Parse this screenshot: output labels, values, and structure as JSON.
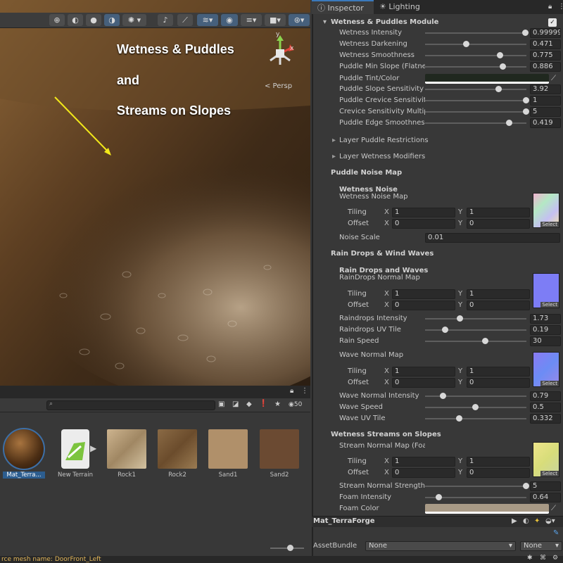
{
  "scene": {
    "overlay_lines": [
      "Wetness & Puddles",
      "and",
      "Streams on Slopes"
    ],
    "persp_label": "< Persp",
    "gizmo_axes": {
      "y": "y",
      "x": "x"
    },
    "toolbar_icons": [
      "globe-icon",
      "sphere-shaded-icon",
      "sphere-solid-icon",
      "moon-icon",
      "sun-icon",
      "audio-mute-icon",
      "fx-icon",
      "layers-icon",
      "visibility-icon",
      "stack-icon",
      "camera-icon",
      "gizmo-icon"
    ],
    "annotation_arrow_color": "#f2e81a"
  },
  "project": {
    "search_placeholder": "",
    "count_label": "50",
    "assets": [
      {
        "name": "Mat_Terra...",
        "kind": "material"
      },
      {
        "name": "New Terrain",
        "kind": "terrain"
      },
      {
        "name": "Rock1",
        "kind": "texture"
      },
      {
        "name": "Rock2",
        "kind": "texture"
      },
      {
        "name": "Sand1",
        "kind": "texture"
      },
      {
        "name": "Sand2",
        "kind": "texture"
      }
    ]
  },
  "status_text": "rce mesh name: DoorFront_Left",
  "inspector": {
    "tabs": [
      {
        "label": "Inspector"
      },
      {
        "label": "Lighting"
      }
    ],
    "module_title": "Wetness & Puddles Module",
    "module_enabled": true,
    "sliders": [
      {
        "label": "Wetness Intensity",
        "value": "0.99999",
        "fraction": 0.995
      },
      {
        "label": "Wetness Darkening",
        "value": "0.471",
        "fraction": 0.41
      },
      {
        "label": "Wetness Smoothness",
        "value": "0.775",
        "fraction": 0.74
      },
      {
        "label": "Puddle Min Slope (Flatness)",
        "value": "0.886",
        "fraction": 0.77
      },
      {
        "label": "Puddle Slope Sensitivity",
        "value": "3.92",
        "fraction": 0.73
      },
      {
        "label": "Puddle Crevice Sensitivity",
        "value": "1",
        "fraction": 1.0
      },
      {
        "label": "Crevice Sensitivity Multiplier",
        "value": "5",
        "fraction": 1.0
      },
      {
        "label": "Puddle Edge Smoothness",
        "value": "0.419",
        "fraction": 0.83
      }
    ],
    "puddle_tint_label": "Puddle Tint/Color",
    "foldouts": [
      "Layer Puddle Restrictions",
      "Layer Wetness Modifiers"
    ],
    "puddle_noise": {
      "header": "Puddle Noise Map",
      "sub_header": "Wetness Noise",
      "map_label": "Wetness Noise Map",
      "tiling_label": "Tiling",
      "offset_label": "Offset",
      "tiling": {
        "x": "1",
        "y": "1"
      },
      "offset": {
        "x": "0",
        "y": "0"
      },
      "noise_scale_label": "Noise Scale",
      "noise_scale": "0.01",
      "select_label": "Select"
    },
    "rain": {
      "header": "Rain Drops & Wind Waves",
      "sub_header": "Rain Drops and Waves",
      "map_label": "RainDrops Normal Map",
      "tiling": {
        "x": "1",
        "y": "1"
      },
      "offset": {
        "x": "0",
        "y": "0"
      },
      "sliders": [
        {
          "label": "Raindrops Intensity",
          "value": "1.73",
          "fraction": 0.35
        },
        {
          "label": "Raindrops UV Tile",
          "value": "0.19",
          "fraction": 0.2
        },
        {
          "label": "Rain Speed",
          "value": "30",
          "fraction": 0.6
        }
      ],
      "wave_map_label": "Wave Normal Map",
      "wave_tiling": {
        "x": "1",
        "y": "1"
      },
      "wave_offset": {
        "x": "0",
        "y": "0"
      },
      "wave_sliders": [
        {
          "label": "Wave Normal Intensity",
          "value": "0.79",
          "fraction": 0.18
        },
        {
          "label": "Wave Speed",
          "value": "0.5",
          "fraction": 0.5
        },
        {
          "label": "Wave UV Tile",
          "value": "0.332",
          "fraction": 0.34
        }
      ]
    },
    "streams": {
      "header": "Wetness Streams on Slopes",
      "map_label": "Stream Normal Map (Foam)",
      "tiling": {
        "x": "1",
        "y": "1"
      },
      "offset": {
        "x": "0",
        "y": "0"
      },
      "sliders": [
        {
          "label": "Stream Normal Strength",
          "value": "5",
          "fraction": 1.0
        },
        {
          "label": "Foam Intensity",
          "value": "0.64",
          "fraction": 0.14
        }
      ],
      "foam_color_label": "Foam Color",
      "foam_color": "#a89a86"
    },
    "material_name": "Mat_TerraForge",
    "assetbundle_label": "AssetBundle",
    "assetbundle_value": "None",
    "assetbundle_variant": "None",
    "axis_x": "X",
    "axis_y": "Y"
  }
}
